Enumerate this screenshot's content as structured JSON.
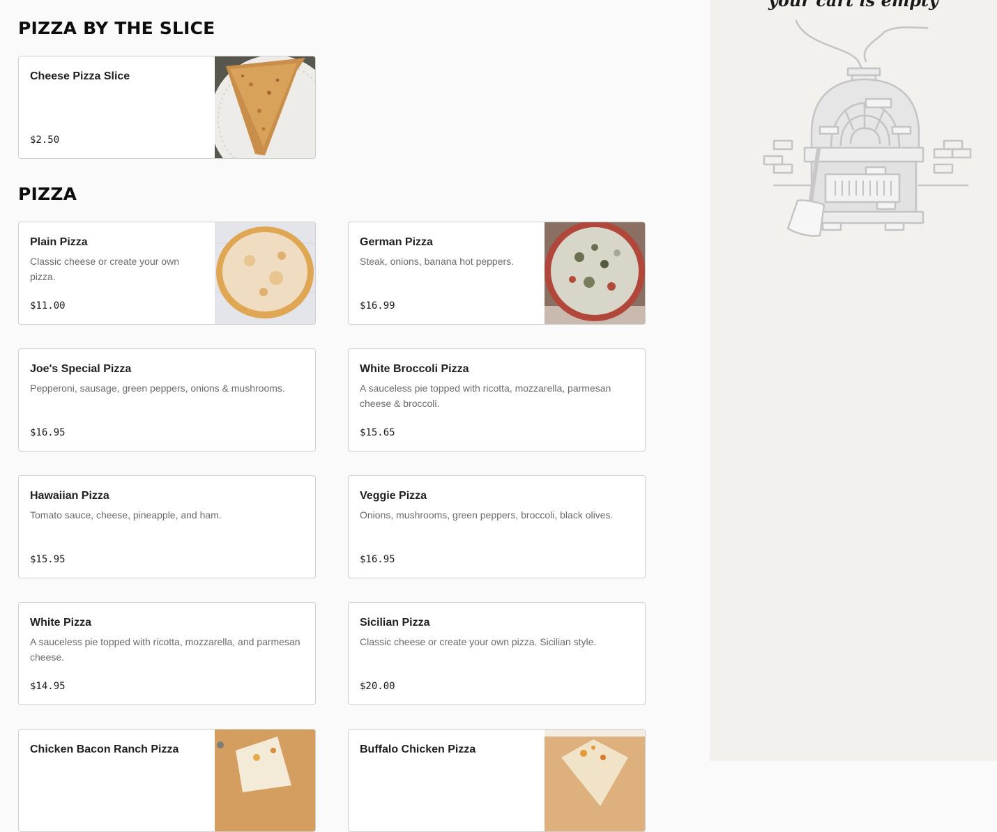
{
  "sections": [
    {
      "title": "PIZZA BY THE SLICE",
      "items": [
        {
          "name": "Cheese Pizza Slice",
          "description": "",
          "price": "$2.50",
          "image": "pizza-slice-photo"
        }
      ]
    },
    {
      "title": "PIZZA",
      "items": [
        {
          "name": "Plain Pizza",
          "description": "Classic cheese or create your own pizza.",
          "price": "$11.00",
          "image": "plain-pizza-photo"
        },
        {
          "name": "German Pizza",
          "description": "Steak, onions, banana hot peppers.",
          "price": "$16.99",
          "image": "german-pizza-photo"
        },
        {
          "name": "Joe's Special Pizza",
          "description": "Pepperoni, sausage, green peppers, onions & mushrooms.",
          "price": "$16.95"
        },
        {
          "name": "White Broccoli Pizza",
          "description": "A sauceless pie topped with ricotta, mozzarella, parmesan cheese & broccoli.",
          "price": "$15.65"
        },
        {
          "name": "Hawaiian Pizza",
          "description": "Tomato sauce, cheese, pineapple, and ham.",
          "price": "$15.95"
        },
        {
          "name": "Veggie Pizza",
          "description": "Onions, mushrooms, green peppers, broccoli, black olives.",
          "price": "$16.95"
        },
        {
          "name": "White Pizza",
          "description": "A sauceless pie topped with ricotta, mozzarella, and parmesan cheese.",
          "price": "$14.95"
        },
        {
          "name": "Sicilian Pizza",
          "description": "Classic cheese or create your own pizza. Sicilian style.",
          "price": "$20.00"
        },
        {
          "name": "Chicken Bacon Ranch Pizza",
          "description": "",
          "price": "",
          "image": "chicken-bacon-ranch-photo"
        },
        {
          "name": "Buffalo Chicken Pizza",
          "description": "",
          "price": "",
          "image": "buffalo-chicken-photo"
        }
      ]
    }
  ],
  "cart": {
    "empty_message": "your cart is empty",
    "illustration": "pizza-oven-illustration"
  },
  "colors": {
    "sidebar_bg": "#f2f1ee",
    "card_border": "#cfcfcf",
    "description_text": "#6a6a6a"
  }
}
